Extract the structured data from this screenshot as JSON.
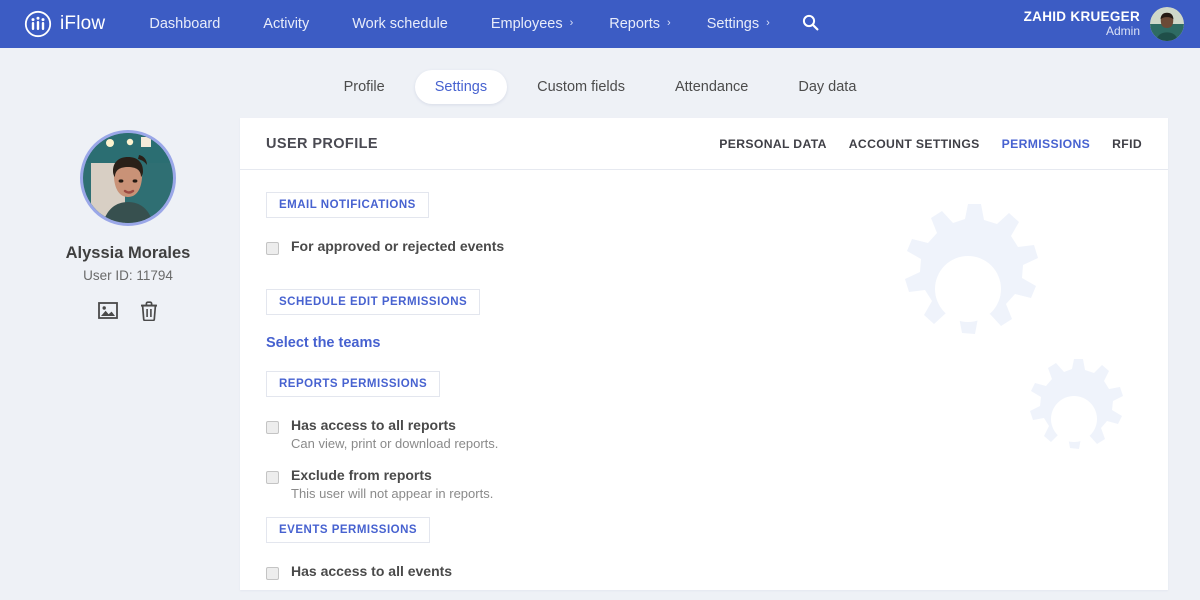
{
  "navbar": {
    "brand": "iFlow",
    "links": [
      {
        "label": "Dashboard",
        "caret": ""
      },
      {
        "label": "Activity",
        "caret": ""
      },
      {
        "label": "Work schedule",
        "caret": ""
      },
      {
        "label": "Employees",
        "caret": "›"
      },
      {
        "label": "Reports",
        "caret": "›"
      },
      {
        "label": "Settings",
        "caret": "›"
      }
    ],
    "search_icon": "search-icon",
    "user": {
      "name": "ZAHID KRUEGER",
      "role": "Admin"
    },
    "bg_color": "#3c5cc4"
  },
  "tabs": [
    {
      "label": "Profile",
      "active": false
    },
    {
      "label": "Settings",
      "active": true
    },
    {
      "label": "Custom fields",
      "active": false
    },
    {
      "label": "Attendance",
      "active": false
    },
    {
      "label": "Day data",
      "active": false
    }
  ],
  "sidebar": {
    "name": "Alyssia Morales",
    "user_id_label": "User ID: 11794",
    "actions": [
      {
        "icon": "image-icon",
        "name": "change-photo"
      },
      {
        "icon": "trash-icon",
        "name": "delete-user"
      }
    ]
  },
  "card": {
    "title": "USER PROFILE",
    "subtabs": [
      {
        "label": "PERSONAL DATA",
        "active": false
      },
      {
        "label": "ACCOUNT SETTINGS",
        "active": false
      },
      {
        "label": "PERMISSIONS",
        "active": true
      },
      {
        "label": "RFID",
        "active": false
      }
    ],
    "sections": {
      "email_notifications": {
        "chip": "EMAIL NOTIFICATIONS",
        "option": {
          "label": "For approved or rejected events",
          "checked": false
        }
      },
      "schedule_edit": {
        "chip": "SCHEDULE EDIT PERMISSIONS",
        "link": "Select the teams"
      },
      "reports": {
        "chip": "REPORTS PERMISSIONS",
        "options": [
          {
            "label": "Has access to all reports",
            "desc": "Can view, print or download reports.",
            "checked": false
          },
          {
            "label": "Exclude from reports",
            "desc": "This user will not appear in reports.",
            "checked": false
          }
        ]
      },
      "events": {
        "chip": "EVENTS PERMISSIONS",
        "options": [
          {
            "label": "Has access to all events",
            "desc": "",
            "checked": false
          }
        ]
      }
    }
  },
  "colors": {
    "brand_blue": "#3c5cc4",
    "accent_blue": "#4762d0",
    "page_bg": "#eef1f6",
    "card_bg": "#ffffff",
    "gear_watermark": "#eff3fb"
  }
}
